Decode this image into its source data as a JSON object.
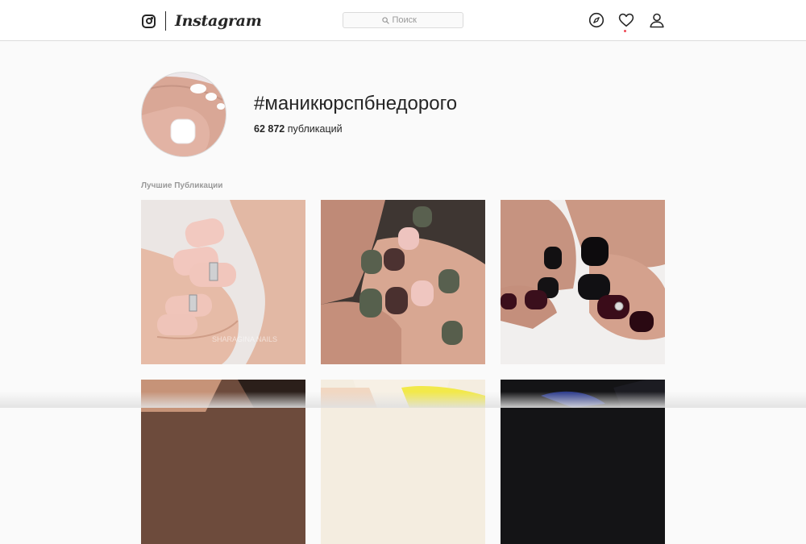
{
  "header": {
    "logo_text": "Instagram",
    "search": {
      "placeholder": "Поиск"
    },
    "icons": [
      "compass-icon",
      "heart-icon",
      "profile-icon"
    ]
  },
  "tag": {
    "title": "#маникюрспбнедорого",
    "post_count": "62 872",
    "post_count_label": "публикаций"
  },
  "section": {
    "top_posts_label": "Лучшие Публикации"
  },
  "posts": [
    {
      "description": "nude pink matte manicure with rhinestone bar",
      "watermark": "SHARAGINA NAILS"
    },
    {
      "description": "khaki, burgundy and pink matte manicure"
    },
    {
      "description": "black and burgundy glossy manicure"
    },
    {
      "description": "manicure photo"
    },
    {
      "description": "yellow manicure photo"
    },
    {
      "description": "dark blue manicure photo"
    }
  ],
  "colors": {
    "accent_dot": "#ed4956",
    "border": "#dbdbdb",
    "muted_text": "#999999"
  }
}
